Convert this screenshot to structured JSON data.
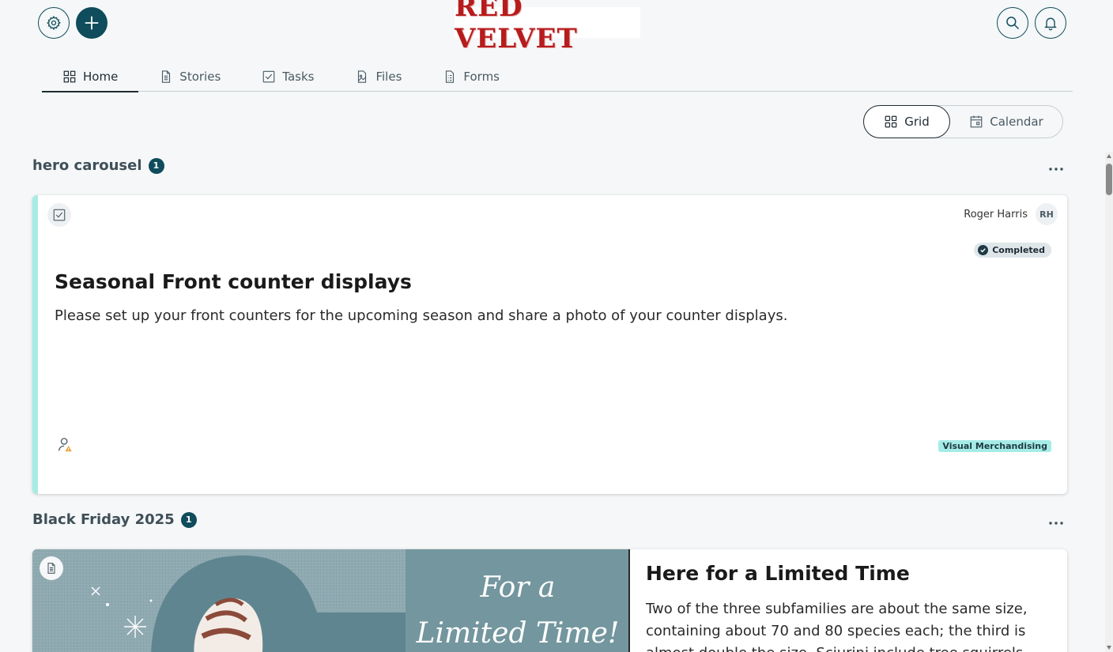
{
  "header": {
    "logo_text": "RED VELVET",
    "settings_icon": "gear-icon",
    "add_icon": "plus-icon",
    "search_icon": "search-icon",
    "notifications_icon": "bell-icon"
  },
  "tabs": [
    {
      "label": "Home",
      "icon": "grid-icon",
      "active": true
    },
    {
      "label": "Stories",
      "icon": "document-icon"
    },
    {
      "label": "Tasks",
      "icon": "task-icon"
    },
    {
      "label": "Files",
      "icon": "file-image-icon"
    },
    {
      "label": "Forms",
      "icon": "form-icon"
    }
  ],
  "view_toggle": {
    "grid_label": "Grid",
    "calendar_label": "Calendar",
    "selected": "Grid"
  },
  "sections": [
    {
      "title": "hero carousel",
      "count": "1",
      "cards": [
        {
          "type_icon": "task-icon",
          "author_name": "Roger Harris",
          "author_initials": "RH",
          "status": "Completed",
          "title": "Seasonal Front counter displays",
          "body": "Please set up your front counters for the upcoming season and share a photo of your counter displays.",
          "tag": "Visual Merchandising",
          "accent_color": "#a6ece6"
        }
      ]
    },
    {
      "title": "Black Friday 2025",
      "count": "1",
      "cards": [
        {
          "type_icon": "document-icon",
          "image_text_line1": "For a",
          "image_text_line2": "Limited Time!",
          "title": "Here for a Limited Time",
          "body": "Two of the three subfamilies are about the same size, containing about 70 and 80 species each; the third is almost double the size. Sciurini include tree squirrels"
        }
      ]
    }
  ],
  "colors": {
    "brand": "#0f4c5c",
    "logo_red": "#b71c1c",
    "tag_bg": "#a6ece6"
  }
}
